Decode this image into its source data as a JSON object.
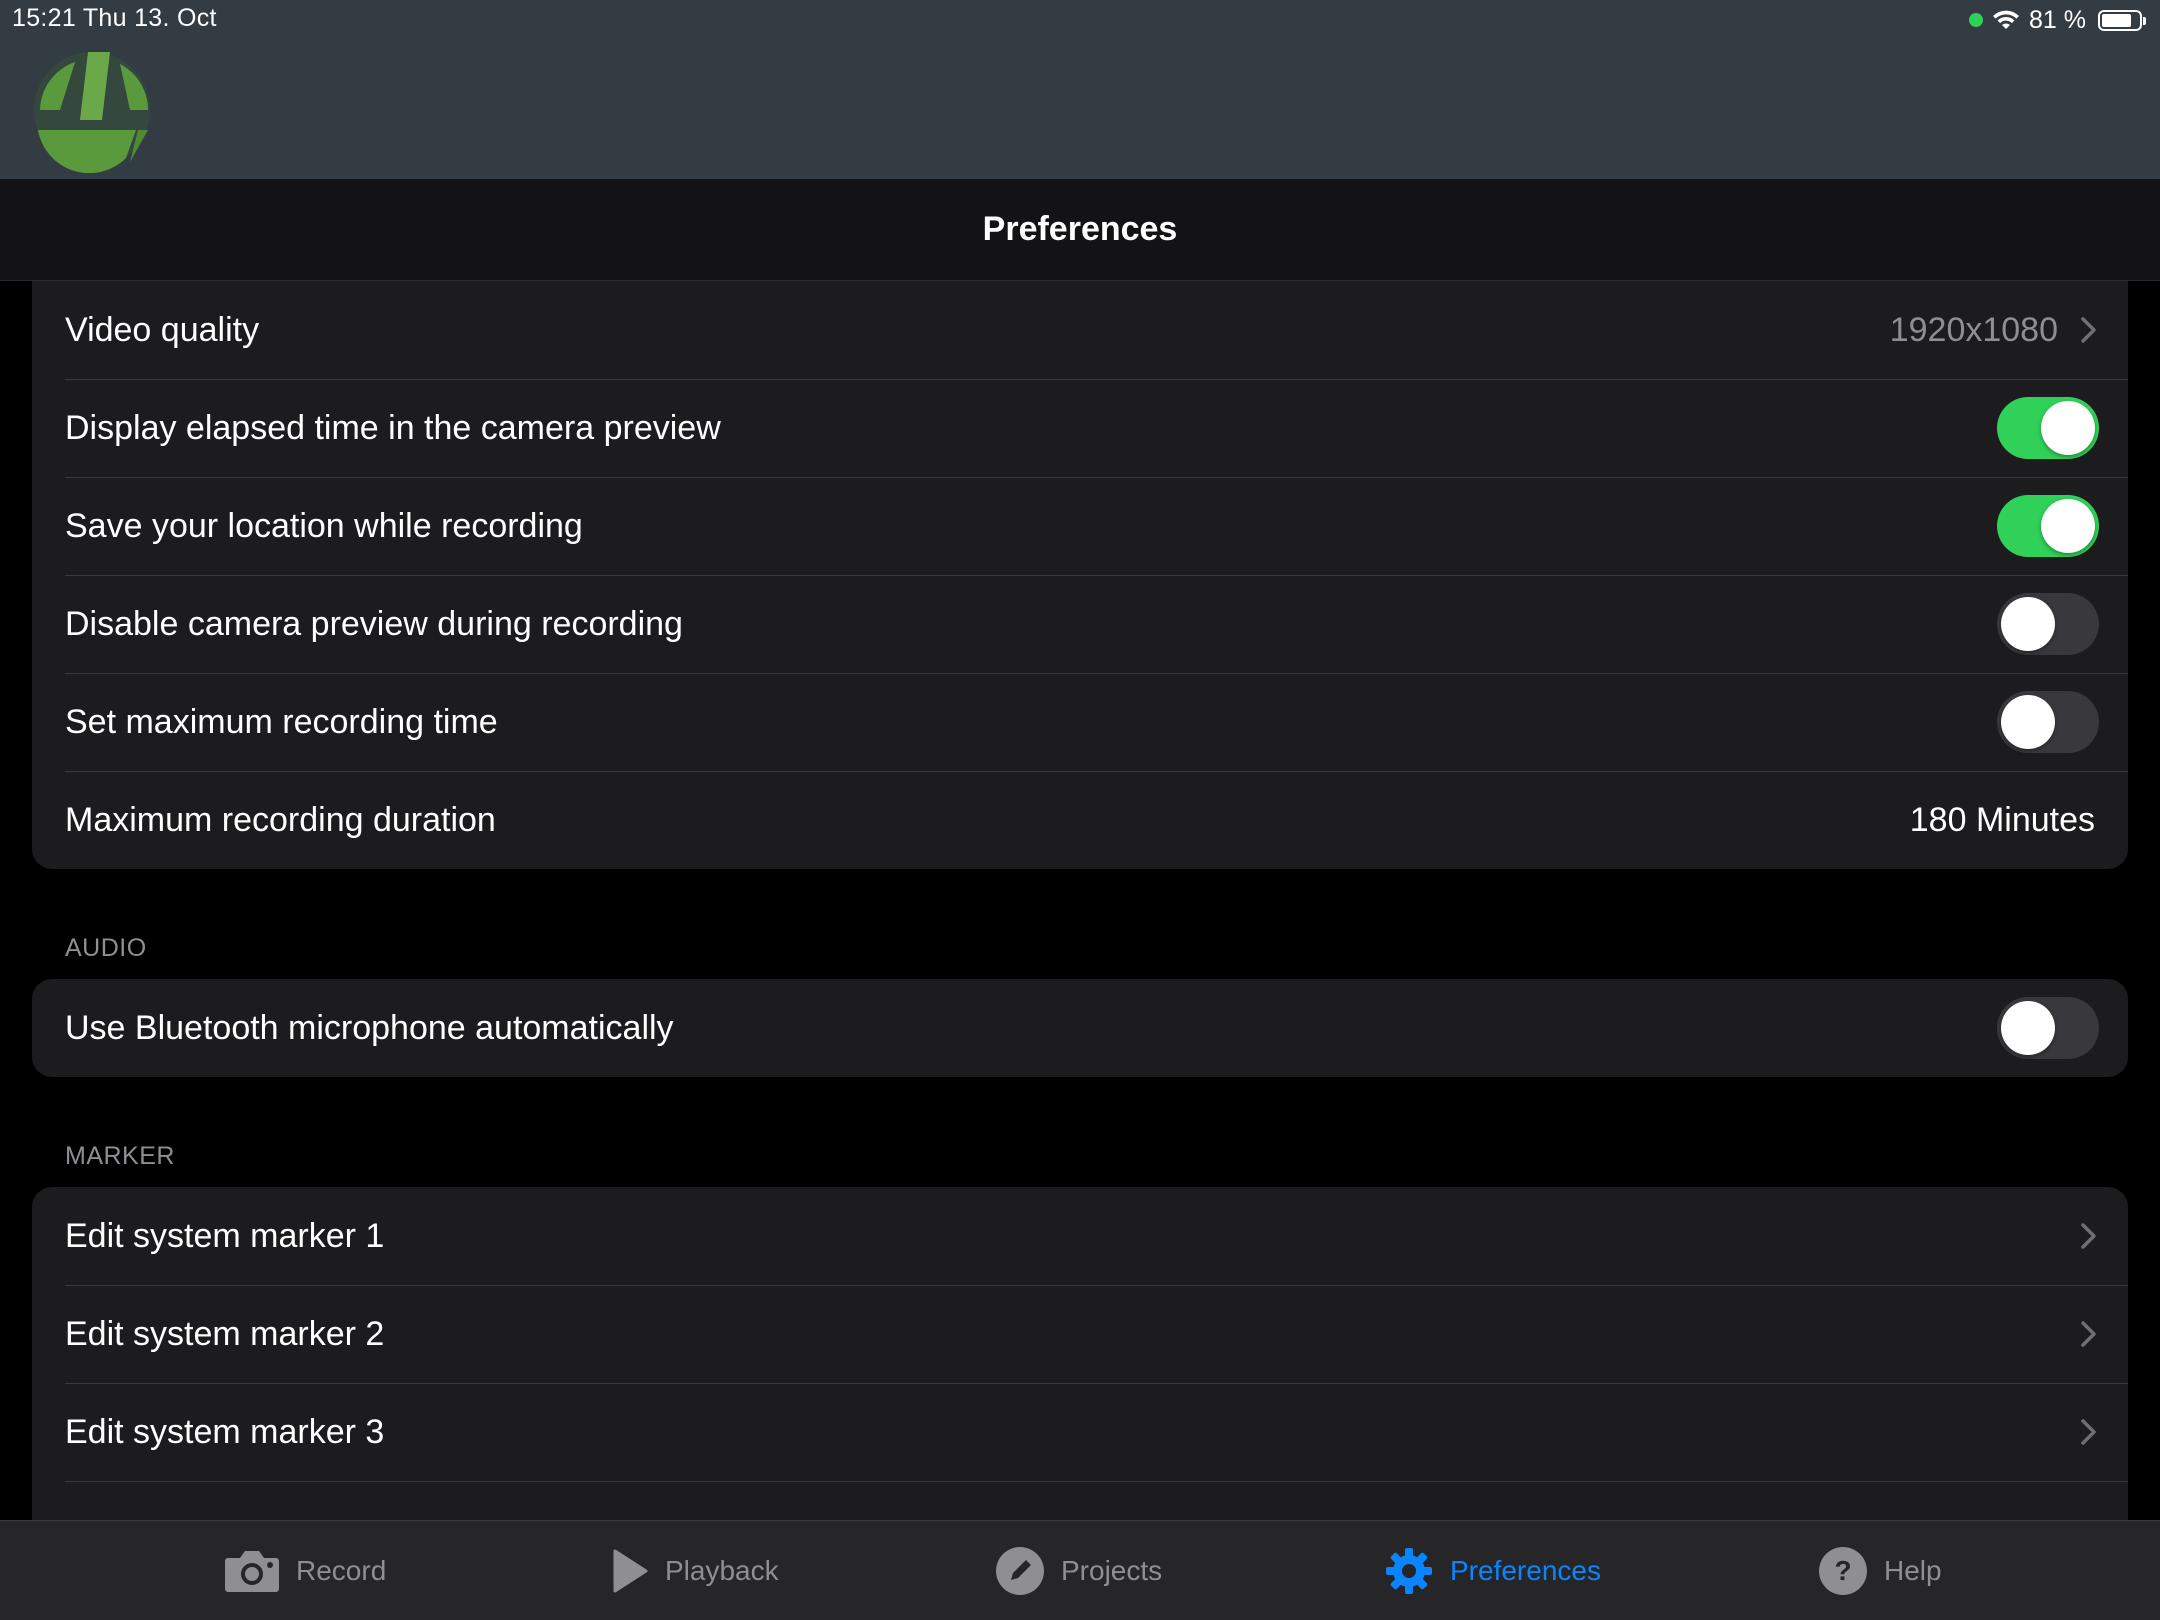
{
  "status_bar": {
    "time_date": "15:21   Thu 13. Oct",
    "battery_text": "81 %",
    "battery_level": 0.81
  },
  "header": {
    "logo_icon": "app-logo-green"
  },
  "nav": {
    "title": "Preferences"
  },
  "video_section": {
    "rows": [
      {
        "label": "Video quality",
        "value": "1920x1080",
        "type": "disclosure"
      },
      {
        "label": "Display elapsed time in the camera preview",
        "type": "toggle",
        "on": true
      },
      {
        "label": "Save your location while recording",
        "type": "toggle",
        "on": true
      },
      {
        "label": "Disable camera preview during recording",
        "type": "toggle",
        "on": false
      },
      {
        "label": "Set maximum recording time",
        "type": "toggle",
        "on": false
      },
      {
        "label": "Maximum recording duration",
        "value": "180 Minutes",
        "type": "value"
      }
    ]
  },
  "audio_section": {
    "header": "AUDIO",
    "rows": [
      {
        "label": "Use Bluetooth microphone automatically",
        "type": "toggle",
        "on": false
      }
    ]
  },
  "marker_section": {
    "header": "MARKER",
    "rows": [
      {
        "label": "Edit system marker 1",
        "type": "disclosure"
      },
      {
        "label": "Edit system marker 2",
        "type": "disclosure"
      },
      {
        "label": "Edit system marker 3",
        "type": "disclosure"
      }
    ]
  },
  "tab_bar": {
    "tabs": [
      {
        "label": "Record",
        "icon": "camera-icon",
        "active": false
      },
      {
        "label": "Playback",
        "icon": "play-icon",
        "active": false
      },
      {
        "label": "Projects",
        "icon": "pencil-icon",
        "active": false
      },
      {
        "label": "Preferences",
        "icon": "gear-icon",
        "active": true
      },
      {
        "label": "Help",
        "icon": "help-icon",
        "active": false
      }
    ]
  },
  "colors": {
    "accent": "#0a84ff",
    "toggle_on": "#30d158",
    "header_bg": "#333b43",
    "logo_green": "#5a9a3c"
  }
}
